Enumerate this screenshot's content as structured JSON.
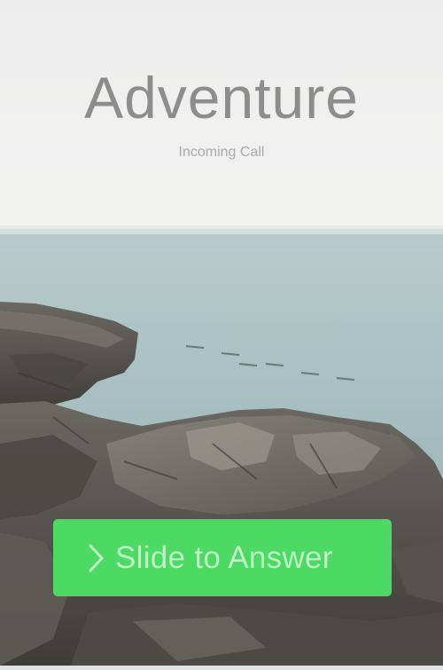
{
  "caller": {
    "name": "Adventure",
    "status": "Incoming Call"
  },
  "answer_slider": {
    "label": "Slide to Answer",
    "icon": "chevron-right-icon",
    "color": "#4cd964"
  },
  "background": {
    "sky_color": "#eeeeee",
    "sea_color": "#a9c2c3",
    "rock_color": "#55524d"
  }
}
